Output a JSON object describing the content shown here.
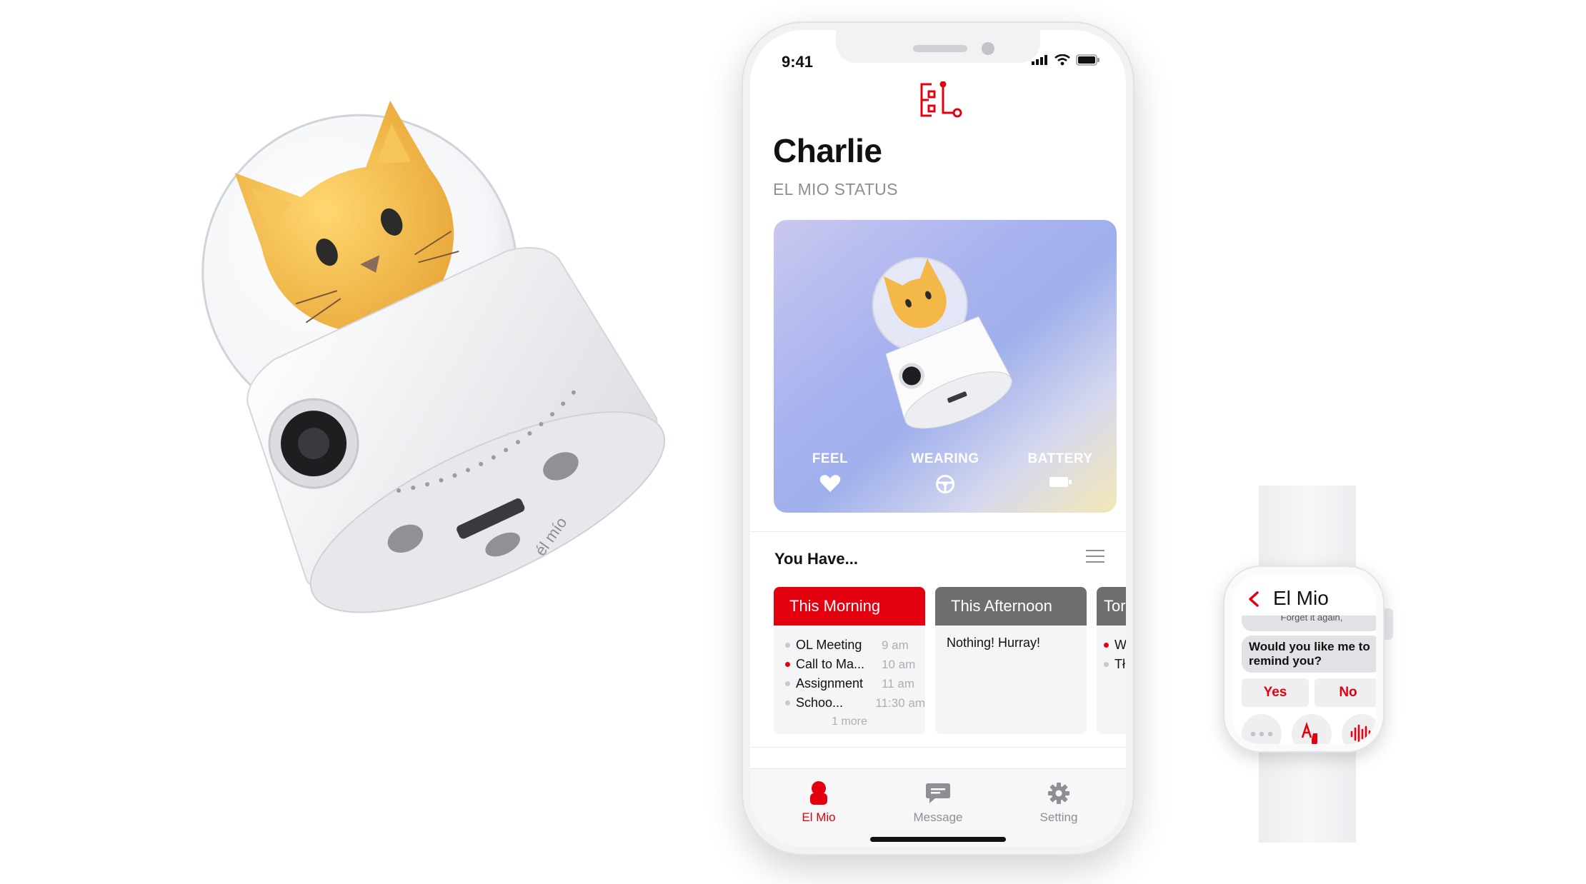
{
  "colors": {
    "accent": "#E3000F",
    "inactive": "#8E8E93",
    "gray_header": "#6E6E6E",
    "feel_heart": "#FFFFFF"
  },
  "device": {
    "brand": "él mío"
  },
  "phone": {
    "status_bar": {
      "time": "9:41"
    },
    "logo": "EL",
    "profile": {
      "name": "Charlie",
      "subtitle": "EL MIO STATUS"
    },
    "metrics": [
      {
        "label": "FEEL",
        "icon": "heart-icon"
      },
      {
        "label": "WEARING",
        "icon": "steering-wheel-icon"
      },
      {
        "label": "BATTERY",
        "icon": "battery-icon"
      }
    ],
    "section_title": "You Have...",
    "cards": [
      {
        "header": "This Morning",
        "header_color": "#E3000F",
        "items": [
          {
            "title": "OL Meeting",
            "time": "9 am",
            "highlight": false
          },
          {
            "title": "Call to Ma...",
            "time": "10 am",
            "highlight": true
          },
          {
            "title": "Assignment",
            "time": "11 am",
            "highlight": false
          },
          {
            "title": "Schoo...",
            "time": "11:30 am",
            "highlight": false
          }
        ],
        "more": "1 more"
      },
      {
        "header": "This Afternoon",
        "header_color": "#6E6E6E",
        "empty_text": "Nothing! Hurray!"
      },
      {
        "header": "Tor",
        "header_color": "#6E6E6E",
        "items": [
          {
            "title": "W",
            "highlight": true
          },
          {
            "title": "Tł",
            "highlight": false
          }
        ]
      }
    ],
    "tabs": [
      {
        "label": "El Mio",
        "icon": "el-mio-icon",
        "active": true
      },
      {
        "label": "Message",
        "icon": "message-icon",
        "active": false
      },
      {
        "label": "Setting",
        "icon": "gear-icon",
        "active": false
      }
    ]
  },
  "watch": {
    "title": "El Mio",
    "previous_message": "Forget it again,",
    "message": "Would you like me to remind you?",
    "yes_label": "Yes",
    "no_label": "No",
    "quick_actions": [
      "more-icon",
      "handwriting-icon",
      "voice-icon"
    ]
  }
}
